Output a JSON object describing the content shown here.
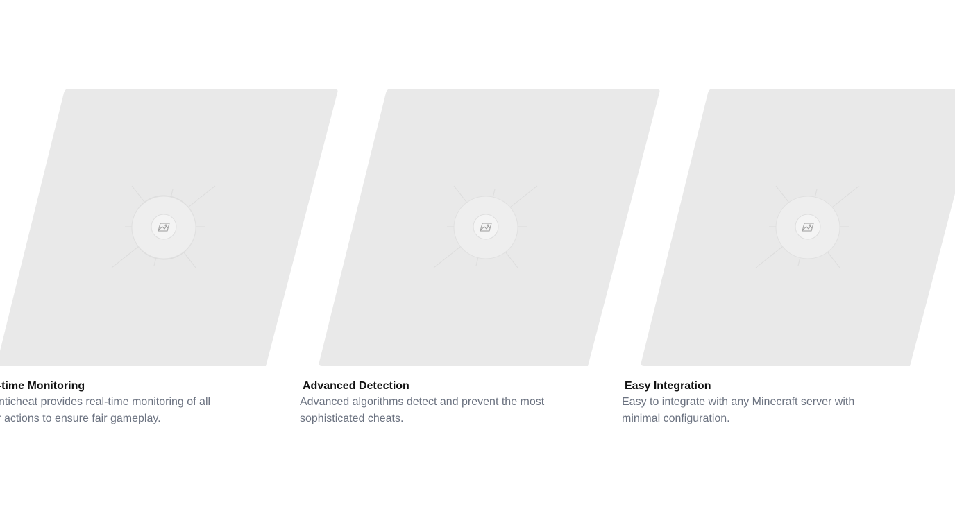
{
  "features": [
    {
      "title": "Real-time Monitoring",
      "description": "Our anticheat provides real-time monitoring of all player actions to ensure fair gameplay.",
      "image_icon": "image-placeholder-icon"
    },
    {
      "title": "Advanced Detection",
      "description": "Advanced algorithms detect and prevent the most sophisticated cheats.",
      "image_icon": "image-placeholder-icon"
    },
    {
      "title": "Easy Integration",
      "description": "Easy to integrate with any Minecraft server with minimal configuration.",
      "image_icon": "image-placeholder-icon"
    }
  ],
  "colors": {
    "card_fill": "#e9e9e9",
    "title": "#111111",
    "description": "#6b7280"
  }
}
